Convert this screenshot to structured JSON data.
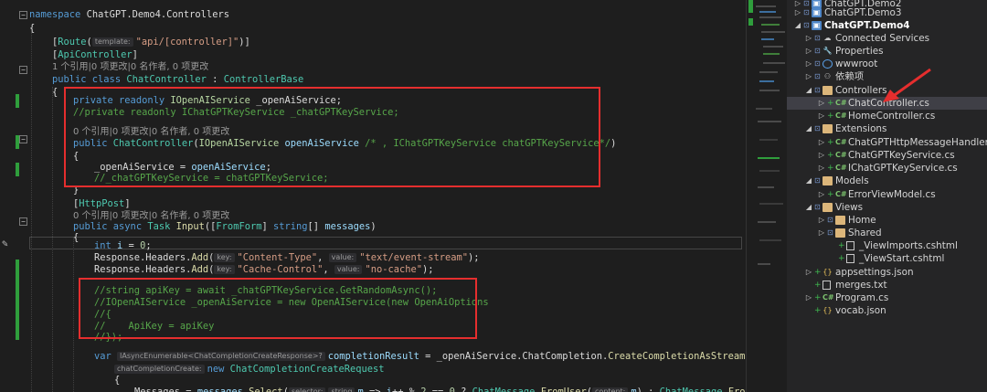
{
  "editor": {
    "lines": [
      {
        "id": "l1",
        "segments": [
          {
            "c": "k",
            "t": "namespace"
          },
          {
            "t": " ChatGPT.Demo4.Controllers"
          }
        ]
      },
      {
        "id": "l2",
        "segments": [
          {
            "t": "{"
          }
        ]
      },
      {
        "id": "l3",
        "segments": [
          {
            "t": "["
          },
          {
            "c": "t",
            "t": "Route"
          },
          {
            "t": "("
          },
          {
            "h": "template:"
          },
          {
            "c": "s",
            "t": "\"api/[controller]\""
          },
          {
            "t": ")]"
          }
        ]
      },
      {
        "id": "l4",
        "segments": [
          {
            "t": "["
          },
          {
            "c": "t",
            "t": "ApiController"
          },
          {
            "t": "]"
          }
        ]
      },
      {
        "id": "l5",
        "lens": true,
        "segments": [
          {
            "t": "1 个引用|0 项更改|0 名作者, 0 项更改"
          }
        ]
      },
      {
        "id": "l6",
        "segments": [
          {
            "c": "k",
            "t": "public class "
          },
          {
            "c": "t",
            "t": "ChatController"
          },
          {
            "t": " : "
          },
          {
            "c": "t",
            "t": "ControllerBase"
          }
        ]
      },
      {
        "id": "l7",
        "segments": [
          {
            "t": "{"
          }
        ]
      },
      {
        "id": "l8",
        "segments": [
          {
            "c": "k",
            "t": "private readonly "
          },
          {
            "c": "i",
            "t": "IOpenAIService"
          },
          {
            "t": " _openAiService;"
          }
        ]
      },
      {
        "id": "l9",
        "segments": [
          {
            "c": "c",
            "t": "//private readonly IChatGPTKeyService _chatGPTKeyService;"
          }
        ]
      },
      {
        "id": "l10",
        "segments": [
          {
            "t": ""
          }
        ]
      },
      {
        "id": "l11",
        "lens": true,
        "segments": [
          {
            "t": "0 个引用|0 项更改|0 名作者, 0 项更改"
          }
        ]
      },
      {
        "id": "l12",
        "segments": [
          {
            "c": "k",
            "t": "public "
          },
          {
            "c": "t",
            "t": "ChatController"
          },
          {
            "t": "("
          },
          {
            "c": "i",
            "t": "IOpenAIService"
          },
          {
            "c": "v",
            "t": " openAiService"
          },
          {
            "c": "c",
            "t": " /* , IChatGPTKeyService chatGPTKeyService*/"
          },
          {
            "t": ")"
          }
        ]
      },
      {
        "id": "l13",
        "segments": [
          {
            "t": "{"
          }
        ]
      },
      {
        "id": "l14",
        "segments": [
          {
            "t": "_openAiService = "
          },
          {
            "c": "v",
            "t": "openAiService"
          },
          {
            "t": ";"
          }
        ]
      },
      {
        "id": "l15",
        "segments": [
          {
            "c": "c",
            "t": "//_chatGPTKeyService = chatGPTKeyService;"
          }
        ]
      },
      {
        "id": "l16",
        "segments": [
          {
            "t": "}"
          }
        ]
      },
      {
        "id": "l17",
        "segments": [
          {
            "t": ""
          }
        ]
      },
      {
        "id": "l18",
        "segments": [
          {
            "t": "["
          },
          {
            "c": "t",
            "t": "HttpPost"
          },
          {
            "t": "]"
          }
        ]
      },
      {
        "id": "l19",
        "lens": true,
        "segments": [
          {
            "t": "0 个引用|0 项更改|0 名作者, 0 项更改"
          }
        ]
      },
      {
        "id": "l20",
        "segments": [
          {
            "c": "k",
            "t": "public async "
          },
          {
            "c": "t",
            "t": "Task"
          },
          {
            "c": "m",
            "t": " Input"
          },
          {
            "t": "(["
          },
          {
            "c": "t",
            "t": "FromForm"
          },
          {
            "t": "] "
          },
          {
            "c": "k",
            "t": "string"
          },
          {
            "t": "[] "
          },
          {
            "c": "v",
            "t": "messages"
          },
          {
            "t": ")"
          }
        ]
      },
      {
        "id": "l21",
        "segments": [
          {
            "t": "{"
          }
        ]
      },
      {
        "id": "l22",
        "segments": [
          {
            "c": "k",
            "t": "int "
          },
          {
            "c": "v",
            "t": "i"
          },
          {
            "t": " = "
          },
          {
            "c": "n",
            "t": "0"
          },
          {
            "t": ";"
          }
        ]
      },
      {
        "id": "l23",
        "segments": [
          {
            "t": "Response.Headers."
          },
          {
            "c": "m",
            "t": "Add"
          },
          {
            "t": "("
          },
          {
            "h": "key:"
          },
          {
            "c": "s",
            "t": "\"Content-Type\""
          },
          {
            "t": ", "
          },
          {
            "h": "value:"
          },
          {
            "c": "s",
            "t": "\"text/event-stream\""
          },
          {
            "t": ");"
          }
        ]
      },
      {
        "id": "l24",
        "segments": [
          {
            "t": "Response.Headers."
          },
          {
            "c": "m",
            "t": "Add"
          },
          {
            "t": "("
          },
          {
            "h": "key:"
          },
          {
            "c": "s",
            "t": "\"Cache-Control\""
          },
          {
            "t": ", "
          },
          {
            "h": "value:"
          },
          {
            "c": "s",
            "t": "\"no-cache\""
          },
          {
            "t": ");"
          }
        ]
      },
      {
        "id": "l25",
        "segments": [
          {
            "t": ""
          }
        ]
      },
      {
        "id": "l26",
        "segments": [
          {
            "c": "c",
            "t": "//string apiKey = await _chatGPTKeyService.GetRandomAsync();"
          }
        ]
      },
      {
        "id": "l27",
        "segments": [
          {
            "c": "c",
            "t": "//IOpenAIService _openAiService = new OpenAIService(new OpenAiOptions"
          }
        ]
      },
      {
        "id": "l28",
        "segments": [
          {
            "c": "c",
            "t": "//{"
          }
        ]
      },
      {
        "id": "l29",
        "segments": [
          {
            "c": "c",
            "t": "//    ApiKey = apiKey"
          }
        ]
      },
      {
        "id": "l30",
        "segments": [
          {
            "c": "c",
            "t": "//});"
          }
        ]
      },
      {
        "id": "l31",
        "segments": [
          {
            "t": ""
          }
        ]
      },
      {
        "id": "l32",
        "segments": [
          {
            "c": "k",
            "t": "var "
          },
          {
            "h": "IAsyncEnumerable<ChatCompletionCreateResponse>?"
          },
          {
            "c": "v",
            "t": "completionResult"
          },
          {
            "t": " = _openAiService.ChatCompletion."
          },
          {
            "c": "m",
            "t": "CreateCompletionAsStream"
          },
          {
            "t": "("
          }
        ]
      },
      {
        "id": "l33",
        "segments": [
          {
            "h": "chatCompletionCreate:"
          },
          {
            "c": "k",
            "t": "new "
          },
          {
            "c": "t",
            "t": "ChatCompletionCreateRequest"
          }
        ]
      },
      {
        "id": "l34",
        "segments": [
          {
            "t": "{"
          }
        ]
      },
      {
        "id": "l35",
        "segments": [
          {
            "t": "Messages = "
          },
          {
            "c": "v",
            "t": "messages"
          },
          {
            "t": "."
          },
          {
            "c": "m",
            "t": "Select"
          },
          {
            "t": "("
          },
          {
            "h": "selector:"
          },
          {
            "h": "string"
          },
          {
            "c": "v",
            "t": "m"
          },
          {
            "t": " => "
          },
          {
            "c": "v",
            "t": "i"
          },
          {
            "t": "++ % "
          },
          {
            "c": "n",
            "t": "2"
          },
          {
            "t": " == "
          },
          {
            "c": "n",
            "t": "0"
          },
          {
            "t": " ? "
          },
          {
            "c": "t",
            "t": "ChatMessage"
          },
          {
            "t": "."
          },
          {
            "c": "m",
            "t": "FromUser"
          },
          {
            "t": "("
          },
          {
            "h": "content:"
          },
          {
            "c": "v",
            "t": "m"
          },
          {
            "t": ") : "
          },
          {
            "c": "t",
            "t": "ChatMessage"
          },
          {
            "t": "."
          },
          {
            "c": "m",
            "t": "FromAssis"
          }
        ]
      }
    ]
  },
  "explorer": {
    "items": [
      {
        "id": "e0",
        "label": "ChatGPT.Demo2",
        "icon": "project-icon",
        "arrow": "▷"
      },
      {
        "id": "e1",
        "label": "ChatGPT.Demo3",
        "icon": "project-icon",
        "arrow": "▷"
      },
      {
        "id": "e2",
        "label": "ChatGPT.Demo4",
        "icon": "project-icon",
        "arrow": "◢",
        "bold": true
      },
      {
        "id": "e3",
        "label": "Connected Services",
        "icon": "connected-services-icon",
        "arrow": "▷"
      },
      {
        "id": "e4",
        "label": "Properties",
        "icon": "wrench-icon",
        "arrow": "▷"
      },
      {
        "id": "e5",
        "label": "wwwroot",
        "icon": "globe-icon",
        "arrow": "▷"
      },
      {
        "id": "e6",
        "label": "依赖项",
        "icon": "dependencies-icon",
        "arrow": "▷"
      },
      {
        "id": "e7",
        "label": "Controllers",
        "icon": "folder-icon",
        "arrow": "◢"
      },
      {
        "id": "e8",
        "label": "ChatController.cs",
        "icon": "csharp-file-icon",
        "arrow": "▷",
        "selected": true
      },
      {
        "id": "e9",
        "label": "HomeController.cs",
        "icon": "csharp-file-icon",
        "arrow": "▷"
      },
      {
        "id": "e10",
        "label": "Extensions",
        "icon": "folder-icon",
        "arrow": "◢"
      },
      {
        "id": "e11",
        "label": "ChatGPTHttpMessageHandler.cs",
        "icon": "csharp-file-icon",
        "arrow": "▷"
      },
      {
        "id": "e12",
        "label": "ChatGPTKeyService.cs",
        "icon": "csharp-file-icon",
        "arrow": "▷"
      },
      {
        "id": "e13",
        "label": "IChatGPTKeyService.cs",
        "icon": "csharp-file-icon",
        "arrow": "▷"
      },
      {
        "id": "e14",
        "label": "Models",
        "icon": "folder-icon",
        "arrow": "◢"
      },
      {
        "id": "e15",
        "label": "ErrorViewModel.cs",
        "icon": "csharp-file-icon",
        "arrow": "▷"
      },
      {
        "id": "e16",
        "label": "Views",
        "icon": "folder-icon",
        "arrow": "◢"
      },
      {
        "id": "e17",
        "label": "Home",
        "icon": "folder-icon",
        "arrow": "▷"
      },
      {
        "id": "e18",
        "label": "Shared",
        "icon": "folder-icon",
        "arrow": "▷"
      },
      {
        "id": "e19",
        "label": "_ViewImports.cshtml",
        "icon": "razor-file-icon",
        "arrow": ""
      },
      {
        "id": "e20",
        "label": "_ViewStart.cshtml",
        "icon": "razor-file-icon",
        "arrow": ""
      },
      {
        "id": "e21",
        "label": "appsettings.json",
        "icon": "json-file-icon",
        "arrow": "▷"
      },
      {
        "id": "e22",
        "label": "merges.txt",
        "icon": "text-file-icon",
        "arrow": ""
      },
      {
        "id": "e23",
        "label": "Program.cs",
        "icon": "csharp-file-icon",
        "arrow": "▷"
      },
      {
        "id": "e24",
        "label": "vocab.json",
        "icon": "json-file-icon",
        "arrow": ""
      }
    ]
  },
  "colors": {
    "editor_bg": "#1e1e1e",
    "explorer_bg": "#252526",
    "selection": "#3f3f46",
    "annotation_red": "#e52e2e",
    "change_green": "#2f9e3c"
  }
}
